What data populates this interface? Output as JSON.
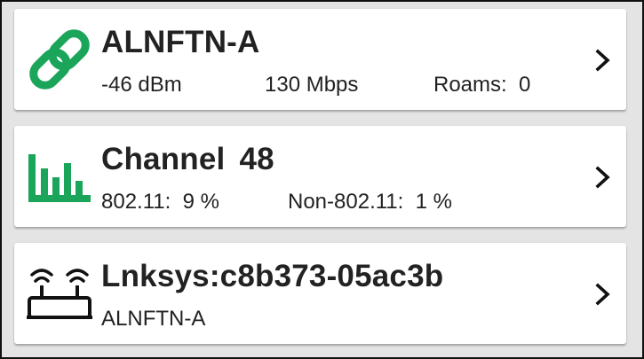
{
  "wifi_link": {
    "ssid": "ALNFTN-A",
    "signal": "-46 dBm",
    "rate": "130 Mbps",
    "roams_label": "Roams:",
    "roams_value": "0",
    "icon": "link-icon",
    "icon_color": "#1aa55a"
  },
  "channel": {
    "label": "Channel",
    "number": "48",
    "util_80211_label": "802.11:",
    "util_80211_value": "9 %",
    "util_non_label": "Non-802.11:",
    "util_non_value": "1 %",
    "icon": "bar-chart-icon",
    "icon_color": "#1aa55a"
  },
  "access_point": {
    "name": "Lnksys:c8b373-05ac3b",
    "ssid": "ALNFTN-A",
    "icon": "router-icon"
  }
}
